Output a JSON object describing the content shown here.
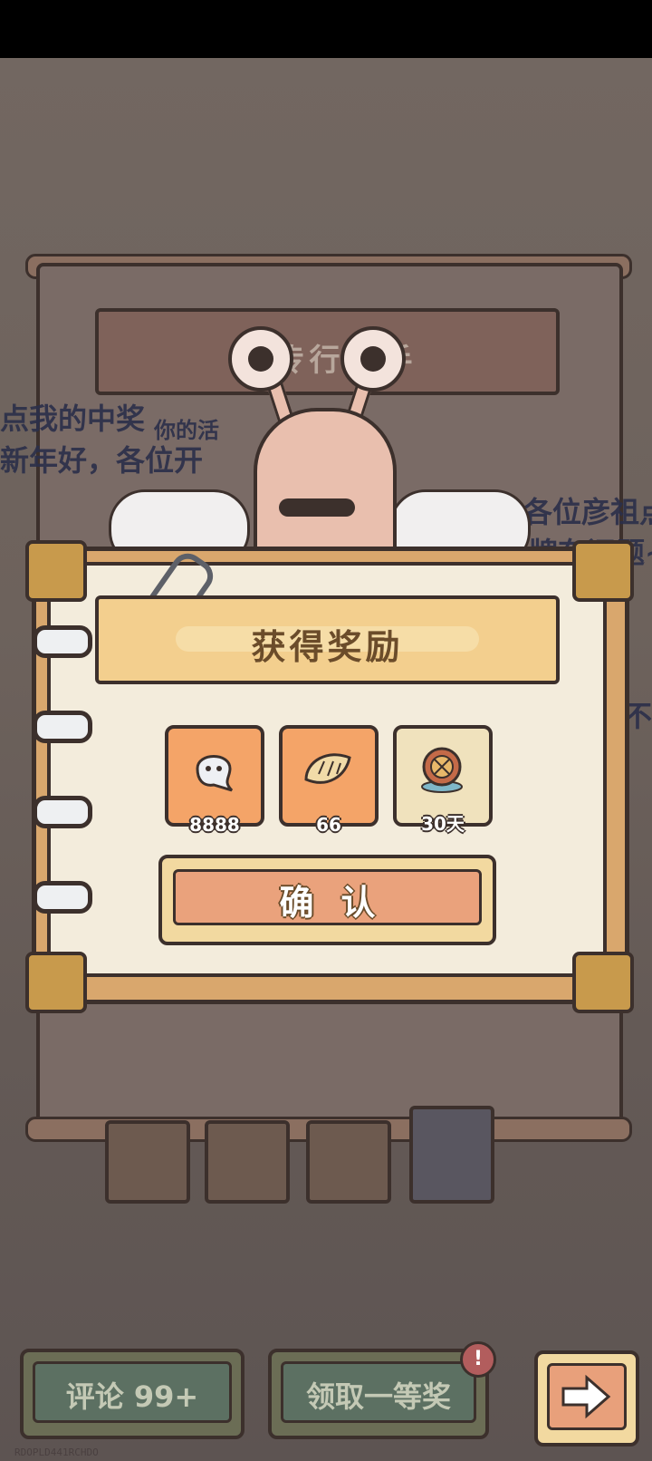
{
  "background": {
    "board_title": "宣传行业手",
    "left_text_1": "点我的中奖",
    "left_text_2": "新年好，各位开",
    "left_text_3": "你的活",
    "right_text_1": "各位彦祖点",
    "right_text_2": "牌有问题~",
    "right_text_3": "不能"
  },
  "dialog": {
    "title": "获得奖励",
    "rewards": [
      {
        "icon": "ghost-icon",
        "qty": "8888"
      },
      {
        "icon": "dumpling-icon",
        "qty": "66"
      },
      {
        "icon": "compass-medal-icon",
        "qty": "30天"
      }
    ],
    "confirm_label": "确认"
  },
  "bottom": {
    "comment_label": "评论 99+",
    "claim_label": "领取一等奖",
    "badge": "!"
  },
  "watermark": "RDOPLD441RCHDO",
  "colors": {
    "paper": "#f3ecdc",
    "header": "#f3cf8e",
    "reward_orange": "#f4a468",
    "confirm_face": "#eaa27c",
    "outline": "#3c302c"
  }
}
